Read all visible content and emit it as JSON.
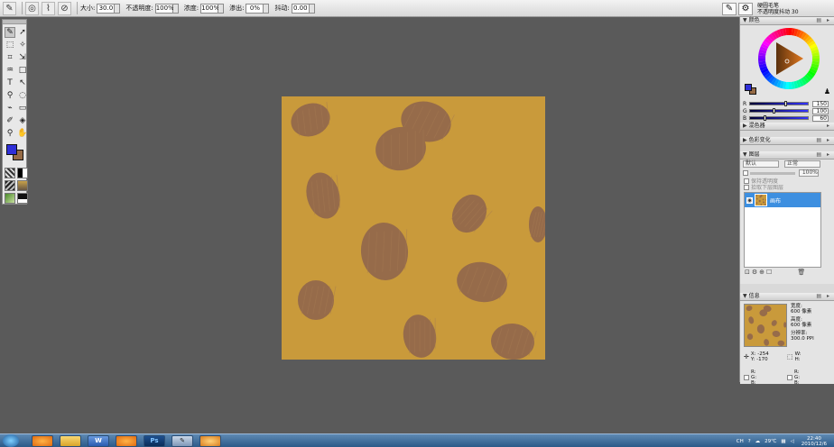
{
  "toolbar": {
    "size_label": "大小:",
    "size_value": "30.0",
    "opacity_label": "不透明度:",
    "opacity_value": "100%",
    "density_label": "浓度:",
    "density_value": "100%",
    "bleed_label": "渗出:",
    "bleed_value": "0%",
    "jitter_label": "抖动:",
    "jitter_value": "0.00",
    "brush_preset_name": "硬圆毛笔",
    "brush_preset_sub": "不透明度抖动 30"
  },
  "colors": {
    "foreground": "#2f2fd8",
    "background": "#966b46",
    "canvas_bg": "#c99a3b",
    "spot": "#966b4a",
    "selection": "#3d8fe0"
  },
  "panels": {
    "color": {
      "title": "颜色",
      "r_label": "R",
      "g_label": "G",
      "b_label": "B",
      "r_value": "150",
      "g_value": "100",
      "b_value": "60"
    },
    "mixer_title": "混色器",
    "color_variation_title": "色彩变化",
    "layers": {
      "title": "图层",
      "composite": "默认",
      "blend": "正常",
      "opacity": "100%",
      "preserve_transparency": "保持透明度",
      "pick_down": "拾取下层图层",
      "layer_name": "画布"
    },
    "info": {
      "title": "信息",
      "width_label": "宽度:",
      "width_value": "600 像素",
      "height_label": "高度:",
      "height_value": "600 像素",
      "res_label": "分辨率:",
      "res_value": "300.0 PPI",
      "x_coord": "X: -254",
      "y_coord": "Y: -170",
      "w_label": "W:",
      "h_label": "H:",
      "r_label": "R:",
      "g_label": "G:",
      "b_label": "B:",
      "sel_r": "R:",
      "sel_g": "G:",
      "sel_b": "B:"
    }
  },
  "taskbar": {
    "ps_label": "Ps",
    "lang": "CH",
    "temp": "29℃",
    "time": "22:40",
    "date": "2010/12/6"
  }
}
